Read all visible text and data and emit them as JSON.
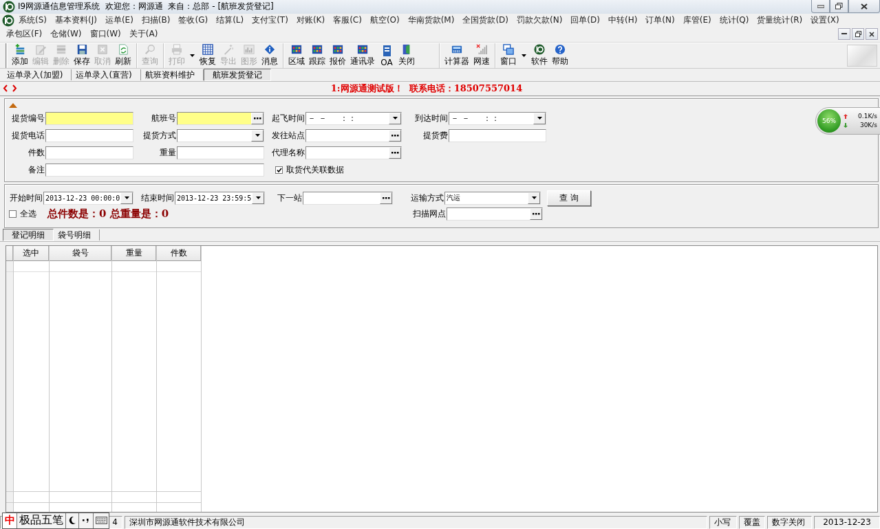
{
  "window": {
    "title": "I9网源通信息管理系统  欢迎您：网源通  来自：总部 - [航班发货登记]"
  },
  "menubar": {
    "rows": [
      [
        "系统(S)",
        "基本资料(J)",
        "运单(E)",
        "扫描(B)",
        "签收(G)",
        "结算(L)",
        "支付宝(T)",
        "对账(K)",
        "客服(C)",
        "航空(O)",
        "华南货款(M)",
        "全国货款(D)",
        "罚款欠款(N)",
        "回单(D)",
        "中转(H)",
        "订单(N)",
        "库管(E)",
        "统计(Q)",
        "货量统计(R)",
        "设置(X)"
      ],
      [
        "承包区(F)",
        "仓储(W)",
        "窗口(W)",
        "关于(A)"
      ]
    ]
  },
  "toolbar": {
    "groups": [
      [
        {
          "kind": "button",
          "label": "添加",
          "disabled": false
        },
        {
          "kind": "button",
          "label": "编辑",
          "disabled": true
        },
        {
          "kind": "button",
          "label": "删除",
          "disabled": true
        },
        {
          "kind": "button",
          "label": "保存",
          "disabled": false
        },
        {
          "kind": "button",
          "label": "取消",
          "disabled": true
        },
        {
          "kind": "button",
          "label": "刷新",
          "disabled": false
        }
      ],
      [
        {
          "kind": "button",
          "label": "查询",
          "disabled": true
        }
      ],
      [
        {
          "kind": "button",
          "label": "打印",
          "disabled": true
        },
        {
          "kind": "arrow"
        },
        {
          "kind": "button",
          "label": "恢复",
          "disabled": false
        },
        {
          "kind": "button",
          "label": "导出",
          "disabled": true
        },
        {
          "kind": "button",
          "label": "图形",
          "disabled": true
        },
        {
          "kind": "button",
          "label": "消息",
          "disabled": false
        }
      ],
      [
        {
          "kind": "button",
          "label": "区域",
          "disabled": false
        },
        {
          "kind": "button",
          "label": "跟踪",
          "disabled": false
        },
        {
          "kind": "button",
          "label": "报价",
          "disabled": false
        },
        {
          "kind": "button",
          "label": "通讯录",
          "disabled": false
        },
        {
          "kind": "button",
          "label": "OA",
          "disabled": false
        },
        {
          "kind": "button",
          "label": "关闭",
          "disabled": false
        }
      ],
      [
        {
          "kind": "button",
          "label": "计算器",
          "disabled": false
        },
        {
          "kind": "button",
          "label": "网速",
          "disabled": false
        }
      ],
      [
        {
          "kind": "button",
          "label": "窗口",
          "disabled": false
        },
        {
          "kind": "arrow"
        },
        {
          "kind": "button",
          "label": "软件",
          "disabled": false
        },
        {
          "kind": "button",
          "label": "帮助",
          "disabled": false
        }
      ]
    ]
  },
  "doc_tabs": [
    {
      "label": "运单录入(加盟)",
      "selected": false
    },
    {
      "label": "运单录入(直营)",
      "selected": false
    },
    {
      "label": "航班资料维护",
      "selected": false
    },
    {
      "label": "航班发货登记",
      "selected": true
    }
  ],
  "notice": "1:网源通测试版！  联系电话：18507557014",
  "pickup_form": {
    "rows": [
      [
        {
          "kind": "text",
          "label": "提货编号",
          "highlighted": true
        },
        {
          "kind": "lookup",
          "label": "航班号",
          "highlighted": true
        },
        {
          "kind": "combo",
          "label": "起飞时间",
          "highlighted": false,
          "value": "－ －     ：："
        },
        {
          "kind": "combo",
          "label": "到达时间",
          "highlighted": false,
          "value": "－ －     ：："
        }
      ],
      [
        {
          "kind": "text",
          "label": "提货电话",
          "highlighted": false
        },
        {
          "kind": "combo",
          "label": "提货方式",
          "highlighted": false
        },
        {
          "kind": "lookup",
          "label": "发往站点",
          "highlighted": false
        },
        {
          "kind": "text",
          "label": "提货费",
          "highlighted": false
        }
      ],
      [
        {
          "kind": "text",
          "label": "件数",
          "highlighted": false
        },
        {
          "kind": "text",
          "label": "重量",
          "highlighted": false
        },
        {
          "kind": "lookup",
          "label": "代理名称",
          "highlighted": false
        }
      ],
      [
        {
          "kind": "memo",
          "label": "备注",
          "highlighted": false
        },
        {
          "kind": "checkbox",
          "label": "取货代关联数据",
          "checked": true
        }
      ]
    ]
  },
  "network_meter": {
    "percent": "56%",
    "upload": "0.1K/s",
    "download": "30K/s"
  },
  "query_panel": {
    "fields": [
      {
        "kind": "combo",
        "label": "开始时间",
        "value": "2013-12-23 00:00:0"
      },
      {
        "kind": "combo",
        "label": "结束时间",
        "value": "2013-12-23 23:59:5"
      },
      {
        "kind": "lookup",
        "label": "下一站"
      },
      {
        "kind": "combo",
        "label": "运输方式",
        "value": "汽运"
      },
      {
        "kind": "button",
        "label": "查 询"
      }
    ],
    "select_all": {
      "label": "全选",
      "checked": false
    },
    "summary": "总件数是：0 总重量是：0",
    "scan_point": {
      "kind": "lookup",
      "label": "扫描网点"
    }
  },
  "detail_tabs": [
    {
      "label": "登记明细",
      "selected": true
    },
    {
      "label": "袋号明细",
      "selected": false
    }
  ],
  "detail_grid": {
    "columns": [
      "选中",
      "袋号",
      "重量",
      "件数"
    ]
  },
  "ime_bar": {
    "mark": "中",
    "name": "极品五笔"
  },
  "status_bar": {
    "cells": [
      "4",
      "深圳市网源通软件技术有限公司",
      "小写",
      "覆盖",
      "数字关闭",
      "2013-12-23"
    ]
  }
}
